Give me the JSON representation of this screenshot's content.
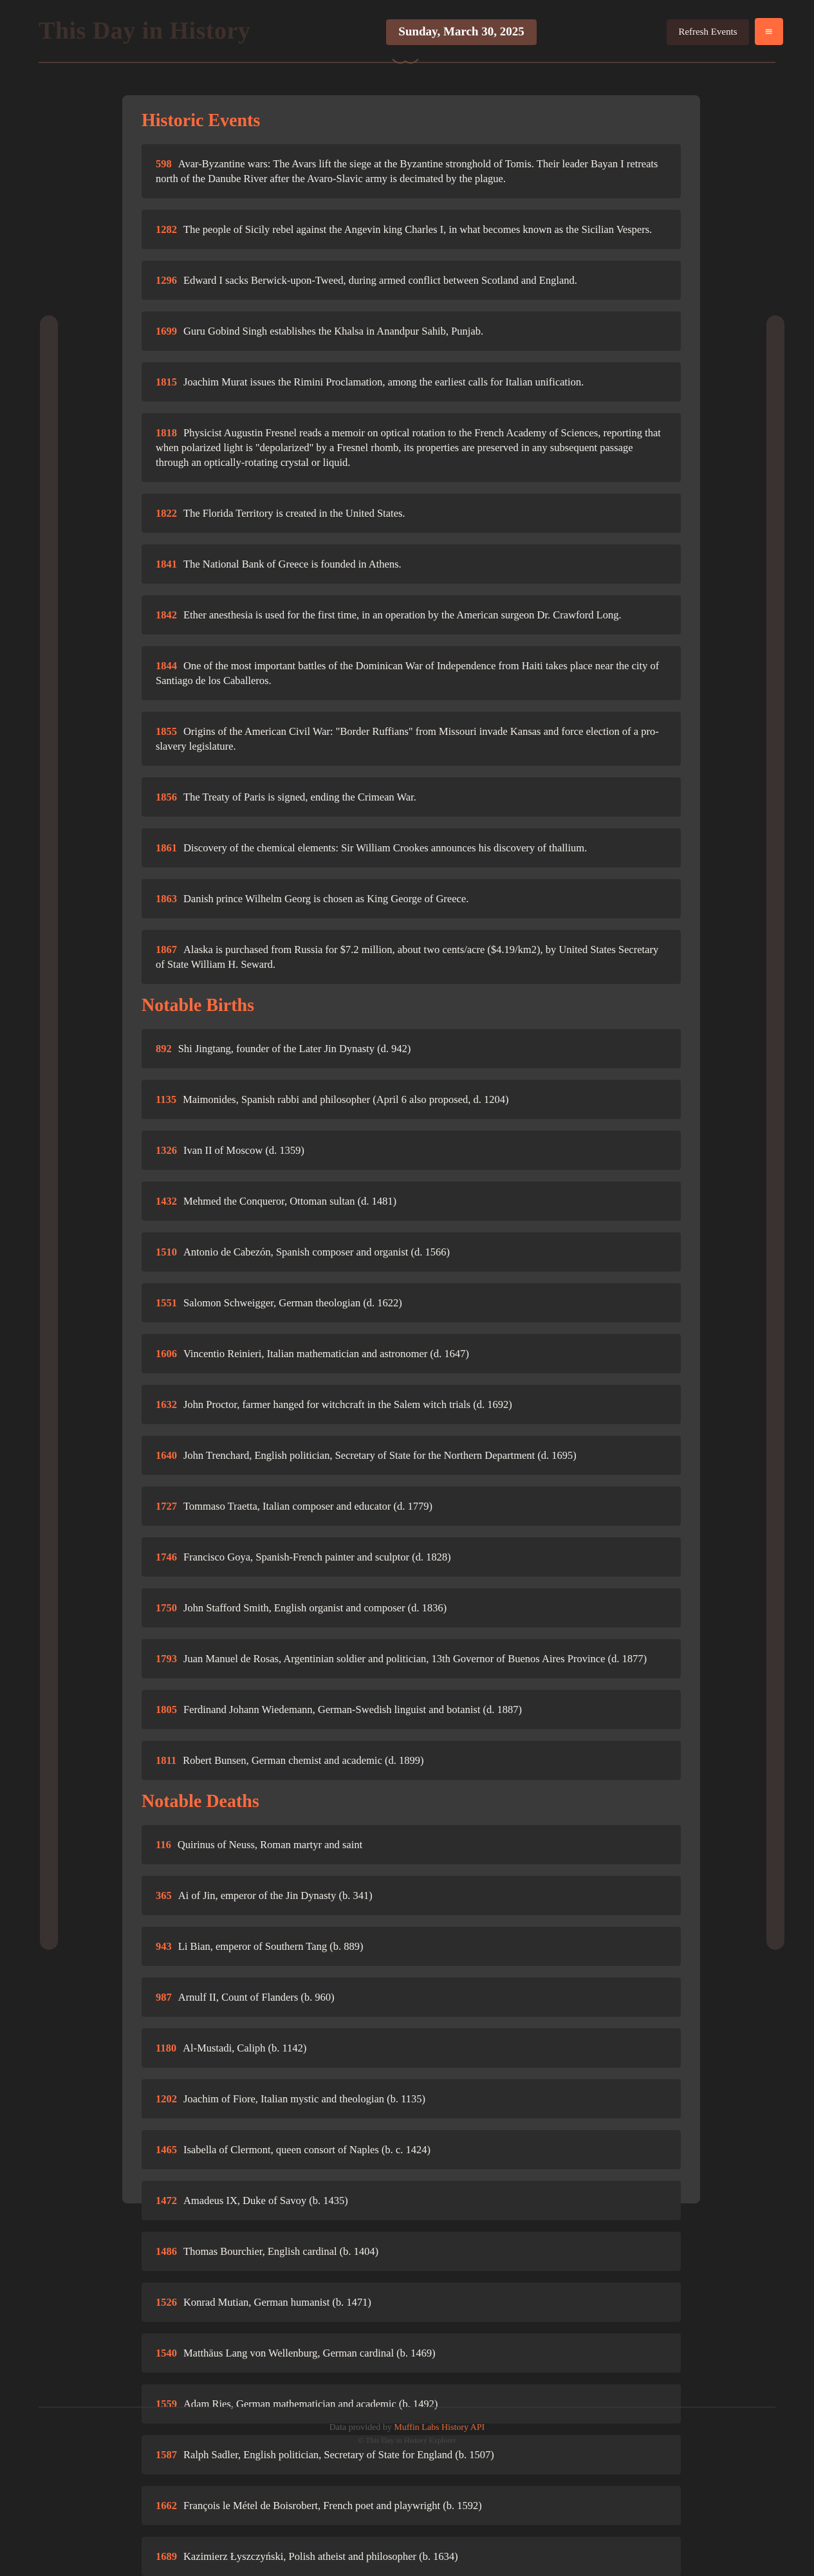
{
  "header": {
    "title": "This Day in History",
    "date": "Sunday, March 30, 2025",
    "refresh_label": "Refresh Events",
    "menu_icon": "≡"
  },
  "sections": {
    "events": {
      "title": "Historic Events",
      "items": [
        {
          "year": "598",
          "text": "Avar-Byzantine wars: The Avars lift the siege at the Byzantine stronghold of Tomis. Their leader Bayan I retreats north of the Danube River after the Avaro-Slavic army is decimated by the plague."
        },
        {
          "year": "1282",
          "text": "The people of Sicily rebel against the Angevin king Charles I, in what becomes known as the Sicilian Vespers."
        },
        {
          "year": "1296",
          "text": "Edward I sacks Berwick-upon-Tweed, during armed conflict between Scotland and England."
        },
        {
          "year": "1699",
          "text": "Guru Gobind Singh establishes the Khalsa in Anandpur Sahib, Punjab."
        },
        {
          "year": "1815",
          "text": "Joachim Murat issues the Rimini Proclamation, among the earliest calls for Italian unification."
        },
        {
          "year": "1818",
          "text": "Physicist Augustin Fresnel reads a memoir on optical rotation to the French Academy of Sciences, reporting that when polarized light is \"depolarized\" by a Fresnel rhomb, its properties are preserved in any subsequent passage through an optically-rotating crystal or liquid."
        },
        {
          "year": "1822",
          "text": "The Florida Territory is created in the United States."
        },
        {
          "year": "1841",
          "text": "The National Bank of Greece is founded in Athens."
        },
        {
          "year": "1842",
          "text": "Ether anesthesia is used for the first time, in an operation by the American surgeon Dr. Crawford Long."
        },
        {
          "year": "1844",
          "text": "One of the most important battles of the Dominican War of Independence from Haiti takes place near the city of Santiago de los Caballeros."
        },
        {
          "year": "1855",
          "text": "Origins of the American Civil War: \"Border Ruffians\" from Missouri invade Kansas and force election of a pro-slavery legislature."
        },
        {
          "year": "1856",
          "text": "The Treaty of Paris is signed, ending the Crimean War."
        },
        {
          "year": "1861",
          "text": "Discovery of the chemical elements: Sir William Crookes announces his discovery of thallium."
        },
        {
          "year": "1863",
          "text": "Danish prince Wilhelm Georg is chosen as King George of Greece."
        },
        {
          "year": "1867",
          "text": "Alaska is purchased from Russia for $7.2 million, about two cents/acre ($4.19/km2), by United States Secretary of State William H. Seward."
        }
      ]
    },
    "births": {
      "title": "Notable Births",
      "items": [
        {
          "year": "892",
          "text": "Shi Jingtang, founder of the Later Jin Dynasty (d. 942)"
        },
        {
          "year": "1135",
          "text": "Maimonides, Spanish rabbi and philosopher (April 6 also proposed, d. 1204)"
        },
        {
          "year": "1326",
          "text": "Ivan II of Moscow (d. 1359)"
        },
        {
          "year": "1432",
          "text": "Mehmed the Conqueror, Ottoman sultan (d. 1481)"
        },
        {
          "year": "1510",
          "text": "Antonio de Cabezón, Spanish composer and organist (d. 1566)"
        },
        {
          "year": "1551",
          "text": "Salomon Schweigger, German theologian (d. 1622)"
        },
        {
          "year": "1606",
          "text": "Vincentio Reinieri, Italian mathematician and astronomer (d. 1647)"
        },
        {
          "year": "1632",
          "text": "John Proctor, farmer hanged for witchcraft in the Salem witch trials (d. 1692)"
        },
        {
          "year": "1640",
          "text": "John Trenchard, English politician, Secretary of State for the Northern Department (d. 1695)"
        },
        {
          "year": "1727",
          "text": "Tommaso Traetta, Italian composer and educator (d. 1779)"
        },
        {
          "year": "1746",
          "text": "Francisco Goya, Spanish-French painter and sculptor (d. 1828)"
        },
        {
          "year": "1750",
          "text": "John Stafford Smith, English organist and composer (d. 1836)"
        },
        {
          "year": "1793",
          "text": "Juan Manuel de Rosas, Argentinian soldier and politician, 13th Governor of Buenos Aires Province (d. 1877)"
        },
        {
          "year": "1805",
          "text": "Ferdinand Johann Wiedemann, German-Swedish linguist and botanist (d. 1887)"
        },
        {
          "year": "1811",
          "text": "Robert Bunsen, German chemist and academic (d. 1899)"
        }
      ]
    },
    "deaths": {
      "title": "Notable Deaths",
      "items": [
        {
          "year": "116",
          "text": "Quirinus of Neuss, Roman martyr and saint"
        },
        {
          "year": "365",
          "text": "Ai of Jin, emperor of the Jin Dynasty (b. 341)"
        },
        {
          "year": "943",
          "text": "Li Bian, emperor of Southern Tang (b. 889)"
        },
        {
          "year": "987",
          "text": "Arnulf II, Count of Flanders (b. 960)"
        },
        {
          "year": "1180",
          "text": "Al-Mustadi, Caliph (b. 1142)"
        },
        {
          "year": "1202",
          "text": "Joachim of Fiore, Italian mystic and theologian (b. 1135)"
        },
        {
          "year": "1465",
          "text": "Isabella of Clermont, queen consort of Naples (b. c. 1424)"
        },
        {
          "year": "1472",
          "text": "Amadeus IX, Duke of Savoy (b. 1435)"
        },
        {
          "year": "1486",
          "text": "Thomas Bourchier, English cardinal (b. 1404)"
        },
        {
          "year": "1526",
          "text": "Konrad Mutian, German humanist (b. 1471)"
        },
        {
          "year": "1540",
          "text": "Matthäus Lang von Wellenburg, German cardinal (b. 1469)"
        },
        {
          "year": "1559",
          "text": "Adam Ries, German mathematician and academic (b. 1492)"
        },
        {
          "year": "1587",
          "text": "Ralph Sadler, English politician, Secretary of State for England (b. 1507)"
        },
        {
          "year": "1662",
          "text": "François le Métel de Boisrobert, French poet and playwright (b. 1592)"
        },
        {
          "year": "1689",
          "text": "Kazimierz Łyszczyński, Polish atheist and philosopher (b. 1634)"
        }
      ]
    }
  },
  "footer": {
    "provided_prefix": "Data provided by ",
    "api_link": "Muffin Labs History API",
    "copyright": "© This Day in History Explorer"
  },
  "colors": {
    "accent": "#ff6b3d",
    "background": "#202020",
    "panel": "#3a3a3a",
    "card": "#2c2c2c",
    "date_badge": "#6a4238"
  },
  "icons": {
    "menu": "menu-icon",
    "ornament": "flourish-ornament-icon"
  }
}
